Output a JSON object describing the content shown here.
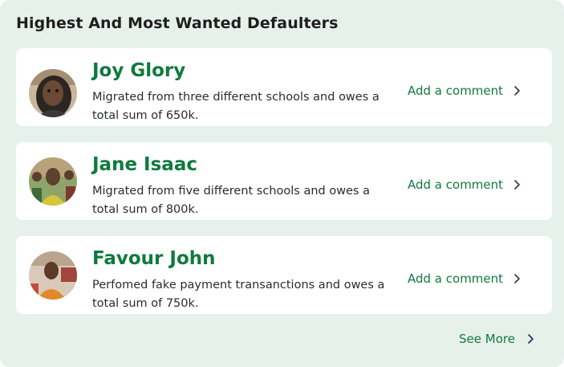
{
  "section": {
    "title": "Highest And Most Wanted Defaulters",
    "see_more_label": "See More"
  },
  "defaulters": [
    {
      "name": "Joy Glory",
      "description": "Migrated from three different schools and owes a total sum of 650k.",
      "action_label": "Add a comment"
    },
    {
      "name": "Jane Isaac",
      "description": "Migrated from five different schools and owes a total sum of 800k.",
      "action_label": "Add a comment"
    },
    {
      "name": "Favour John",
      "description": "Perfomed fake payment transanctions and owes a total sum of 750k.",
      "action_label": "Add a comment"
    }
  ],
  "colors": {
    "panel_bg": "#e6f1ec",
    "accent_green": "#0f7a3e",
    "card_bg": "#ffffff"
  },
  "icons": {
    "action": "chevron-right-icon",
    "avatar": "profile-photo"
  }
}
